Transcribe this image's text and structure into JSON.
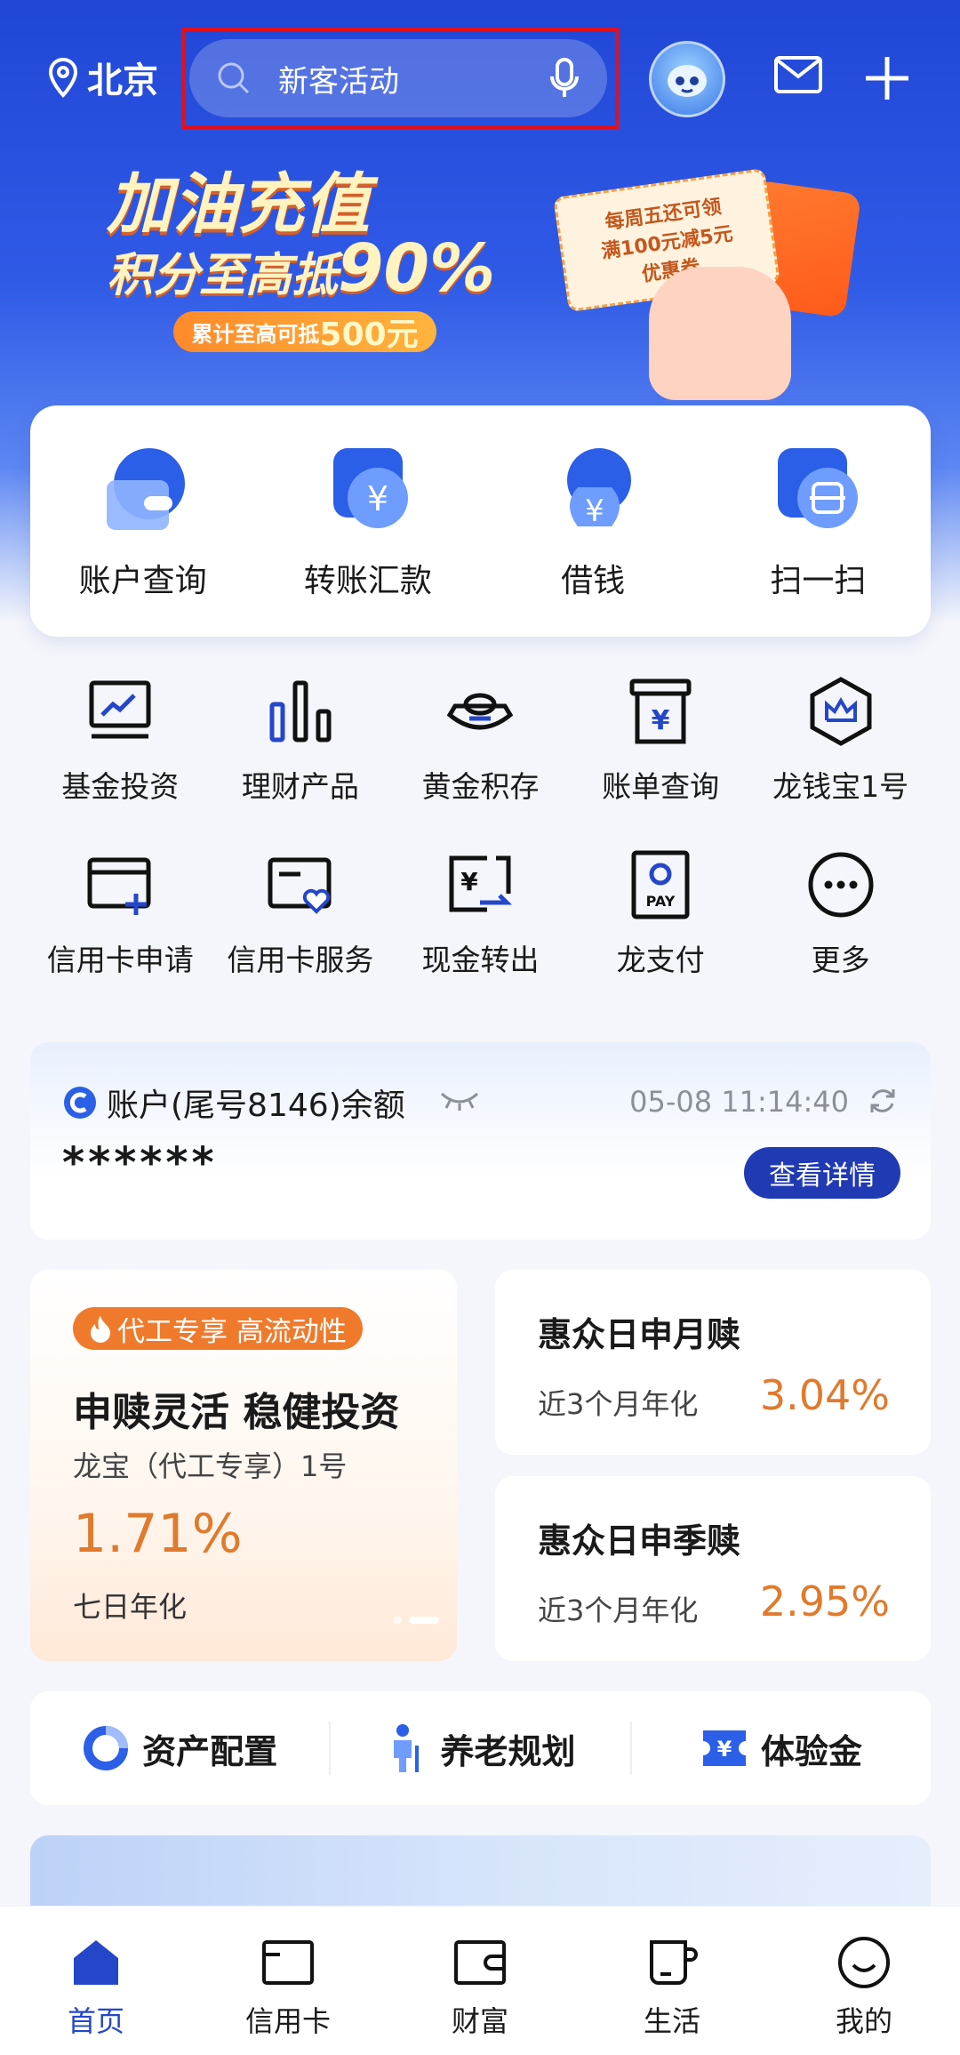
{
  "header": {
    "location": "北京",
    "search_placeholder": "新客活动"
  },
  "banner": {
    "line1": "加油充值",
    "line2_prefix": "积分至高抵",
    "line2_value": "90%",
    "pill_prefix": "累计至高可抵",
    "pill_value": "500元",
    "coupon_line1": "每周五还可领",
    "coupon_line2": "满100元减5元",
    "coupon_line3": "优惠券"
  },
  "quick_actions": [
    {
      "label": "账户查询",
      "icon": "wallet-icon"
    },
    {
      "label": "转账汇款",
      "icon": "yuan-transfer-icon"
    },
    {
      "label": "借钱",
      "icon": "money-bag-icon"
    },
    {
      "label": "扫一扫",
      "icon": "scan-icon"
    }
  ],
  "services": {
    "row1": [
      {
        "label": "基金投资",
        "icon": "fund-chart-icon"
      },
      {
        "label": "理财产品",
        "icon": "bar-chart-icon"
      },
      {
        "label": "黄金积存",
        "icon": "gold-ingot-icon"
      },
      {
        "label": "账单查询",
        "icon": "bill-icon"
      },
      {
        "label": "龙钱宝1号",
        "icon": "crown-hexagon-icon"
      }
    ],
    "row2": [
      {
        "label": "信用卡申请",
        "icon": "card-add-icon"
      },
      {
        "label": "信用卡服务",
        "icon": "card-heart-icon"
      },
      {
        "label": "现金转出",
        "icon": "cash-out-icon"
      },
      {
        "label": "龙支付",
        "icon": "pay-icon"
      },
      {
        "label": "更多",
        "icon": "more-icon"
      }
    ]
  },
  "balance": {
    "title": "账户(尾号8146)余额",
    "timestamp": "05-08 11:14:40",
    "masked_value": "******",
    "detail_button": "查看详情"
  },
  "promo": {
    "tag": "代工专享 高流动性",
    "headline": "申赎灵活 稳健投资",
    "product": "龙宝（代工专享）1号",
    "rate": "1.71%",
    "rate_label": "七日年化"
  },
  "products": [
    {
      "name": "惠众日申月赎",
      "sub": "近3个月年化",
      "rate": "3.04%"
    },
    {
      "name": "惠众日申季赎",
      "sub": "近3个月年化",
      "rate": "2.95%"
    }
  ],
  "features": [
    {
      "label": "资产配置",
      "icon": "pie-icon"
    },
    {
      "label": "养老规划",
      "icon": "elder-icon"
    },
    {
      "label": "体验金",
      "icon": "yuan-ticket-icon"
    }
  ],
  "bottom_nav": [
    {
      "label": "首页",
      "icon": "home-icon",
      "active": true
    },
    {
      "label": "信用卡",
      "icon": "card-icon",
      "active": false
    },
    {
      "label": "财富",
      "icon": "wealth-wallet-icon",
      "active": false
    },
    {
      "label": "生活",
      "icon": "cup-icon",
      "active": false
    },
    {
      "label": "我的",
      "icon": "smile-icon",
      "active": false
    }
  ],
  "colors": {
    "primary_blue": "#2146d6",
    "accent_orange": "#e07a2c",
    "button_navy": "#203ab3",
    "highlight_red": "#e0101d"
  }
}
